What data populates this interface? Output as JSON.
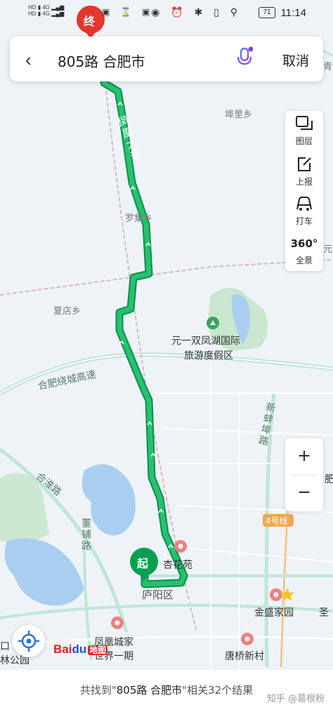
{
  "status_bar": {
    "time": "11:14",
    "battery": "71",
    "signal_labels": "HD 4G\nHD 4G"
  },
  "search": {
    "back_icon": "chevron-left-icon",
    "query": "805路 合肥市",
    "cancel_label": "取消"
  },
  "tools": [
    {
      "icon": "layers-icon",
      "label": "图层"
    },
    {
      "icon": "report-icon",
      "label": "上报"
    },
    {
      "icon": "taxi-icon",
      "label": "打车"
    },
    {
      "icon": "panorama-icon",
      "label": "全景",
      "badge": "360°"
    }
  ],
  "zoom": {
    "in_label": "+",
    "out_label": "−"
  },
  "markers": {
    "start": "起",
    "end": "终"
  },
  "map_labels": {
    "fenghuang_road": "凤凰大道",
    "fuli": "埠里乡",
    "luoji": "罗集乡",
    "xiadian": "夏店乡",
    "resort_1": "元一双凤湖国际",
    "resort_2": "旅游度假区",
    "ring_expressway": "合肥绕城高速",
    "hehuai": "合淮路",
    "xinbeng": "新蚌埠路",
    "dongpu": "董铺路",
    "line4": "4号线",
    "xinghuayuan": "杏花苑",
    "luyang": "庐阳区",
    "jinsheng": "金盛家园",
    "fenghuang_city": "凤凰城家",
    "world_phase1": "世界一期",
    "tangqiao": "唐桥新村",
    "yuan_edge": "元",
    "qing_edge": "青",
    "sheng_edge": "圣",
    "fei_edge": "肥",
    "park_edge": "林公园",
    "park_edge2": "口"
  },
  "logo": {
    "bai": "Bai",
    "du": "du",
    "ditu": "地图"
  },
  "bottom": {
    "prefix": "共找到\"",
    "query": "805路 合肥市",
    "suffix": "\"相关32个结果",
    "watermark": "知乎 @葛根粉"
  }
}
